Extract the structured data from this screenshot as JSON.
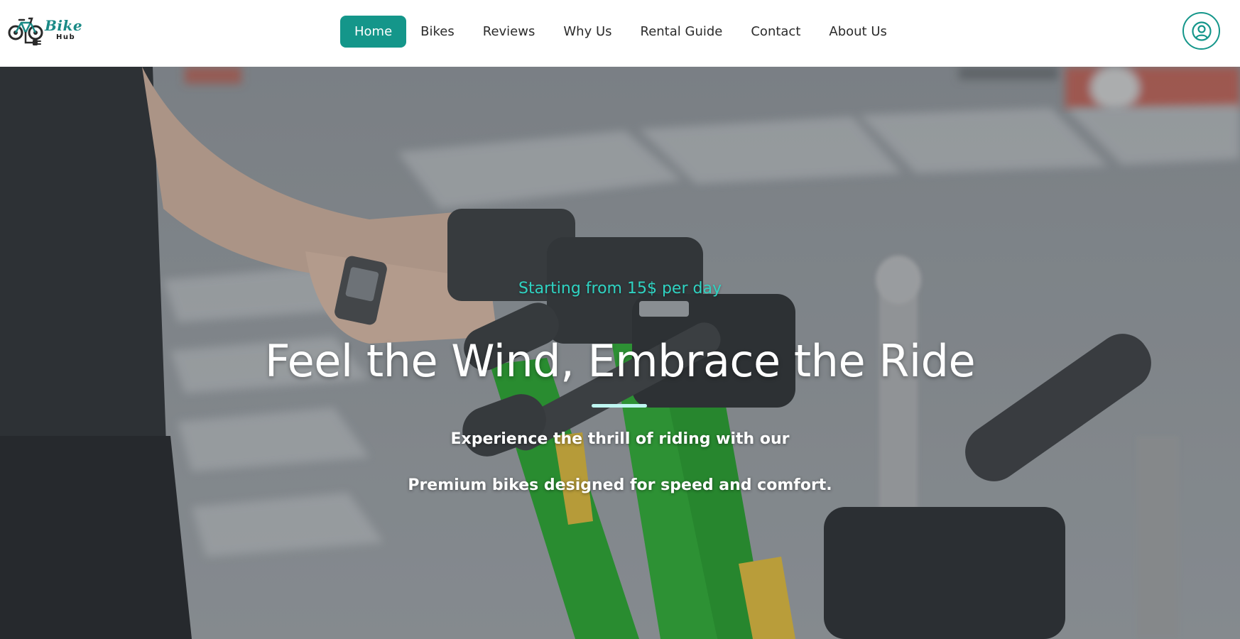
{
  "brand": {
    "name": "Bike",
    "sub": "Hub",
    "accent": "#14968a"
  },
  "nav": {
    "items": [
      {
        "label": "Home",
        "active": true
      },
      {
        "label": "Bikes",
        "active": false
      },
      {
        "label": "Reviews",
        "active": false
      },
      {
        "label": "Why Us",
        "active": false
      },
      {
        "label": "Rental Guide",
        "active": false
      },
      {
        "label": "Contact",
        "active": false
      },
      {
        "label": "About Us",
        "active": false
      }
    ]
  },
  "user_button": {
    "icon": "user-circle-icon"
  },
  "hero": {
    "tagline": "Starting from 15$ per day",
    "headline": "Feel the Wind, Embrace the Ride",
    "description_line1": "Experience the thrill of riding with our",
    "description_line2": "Premium bikes designed for speed and comfort.",
    "tagline_color": "#2fd3c2"
  }
}
